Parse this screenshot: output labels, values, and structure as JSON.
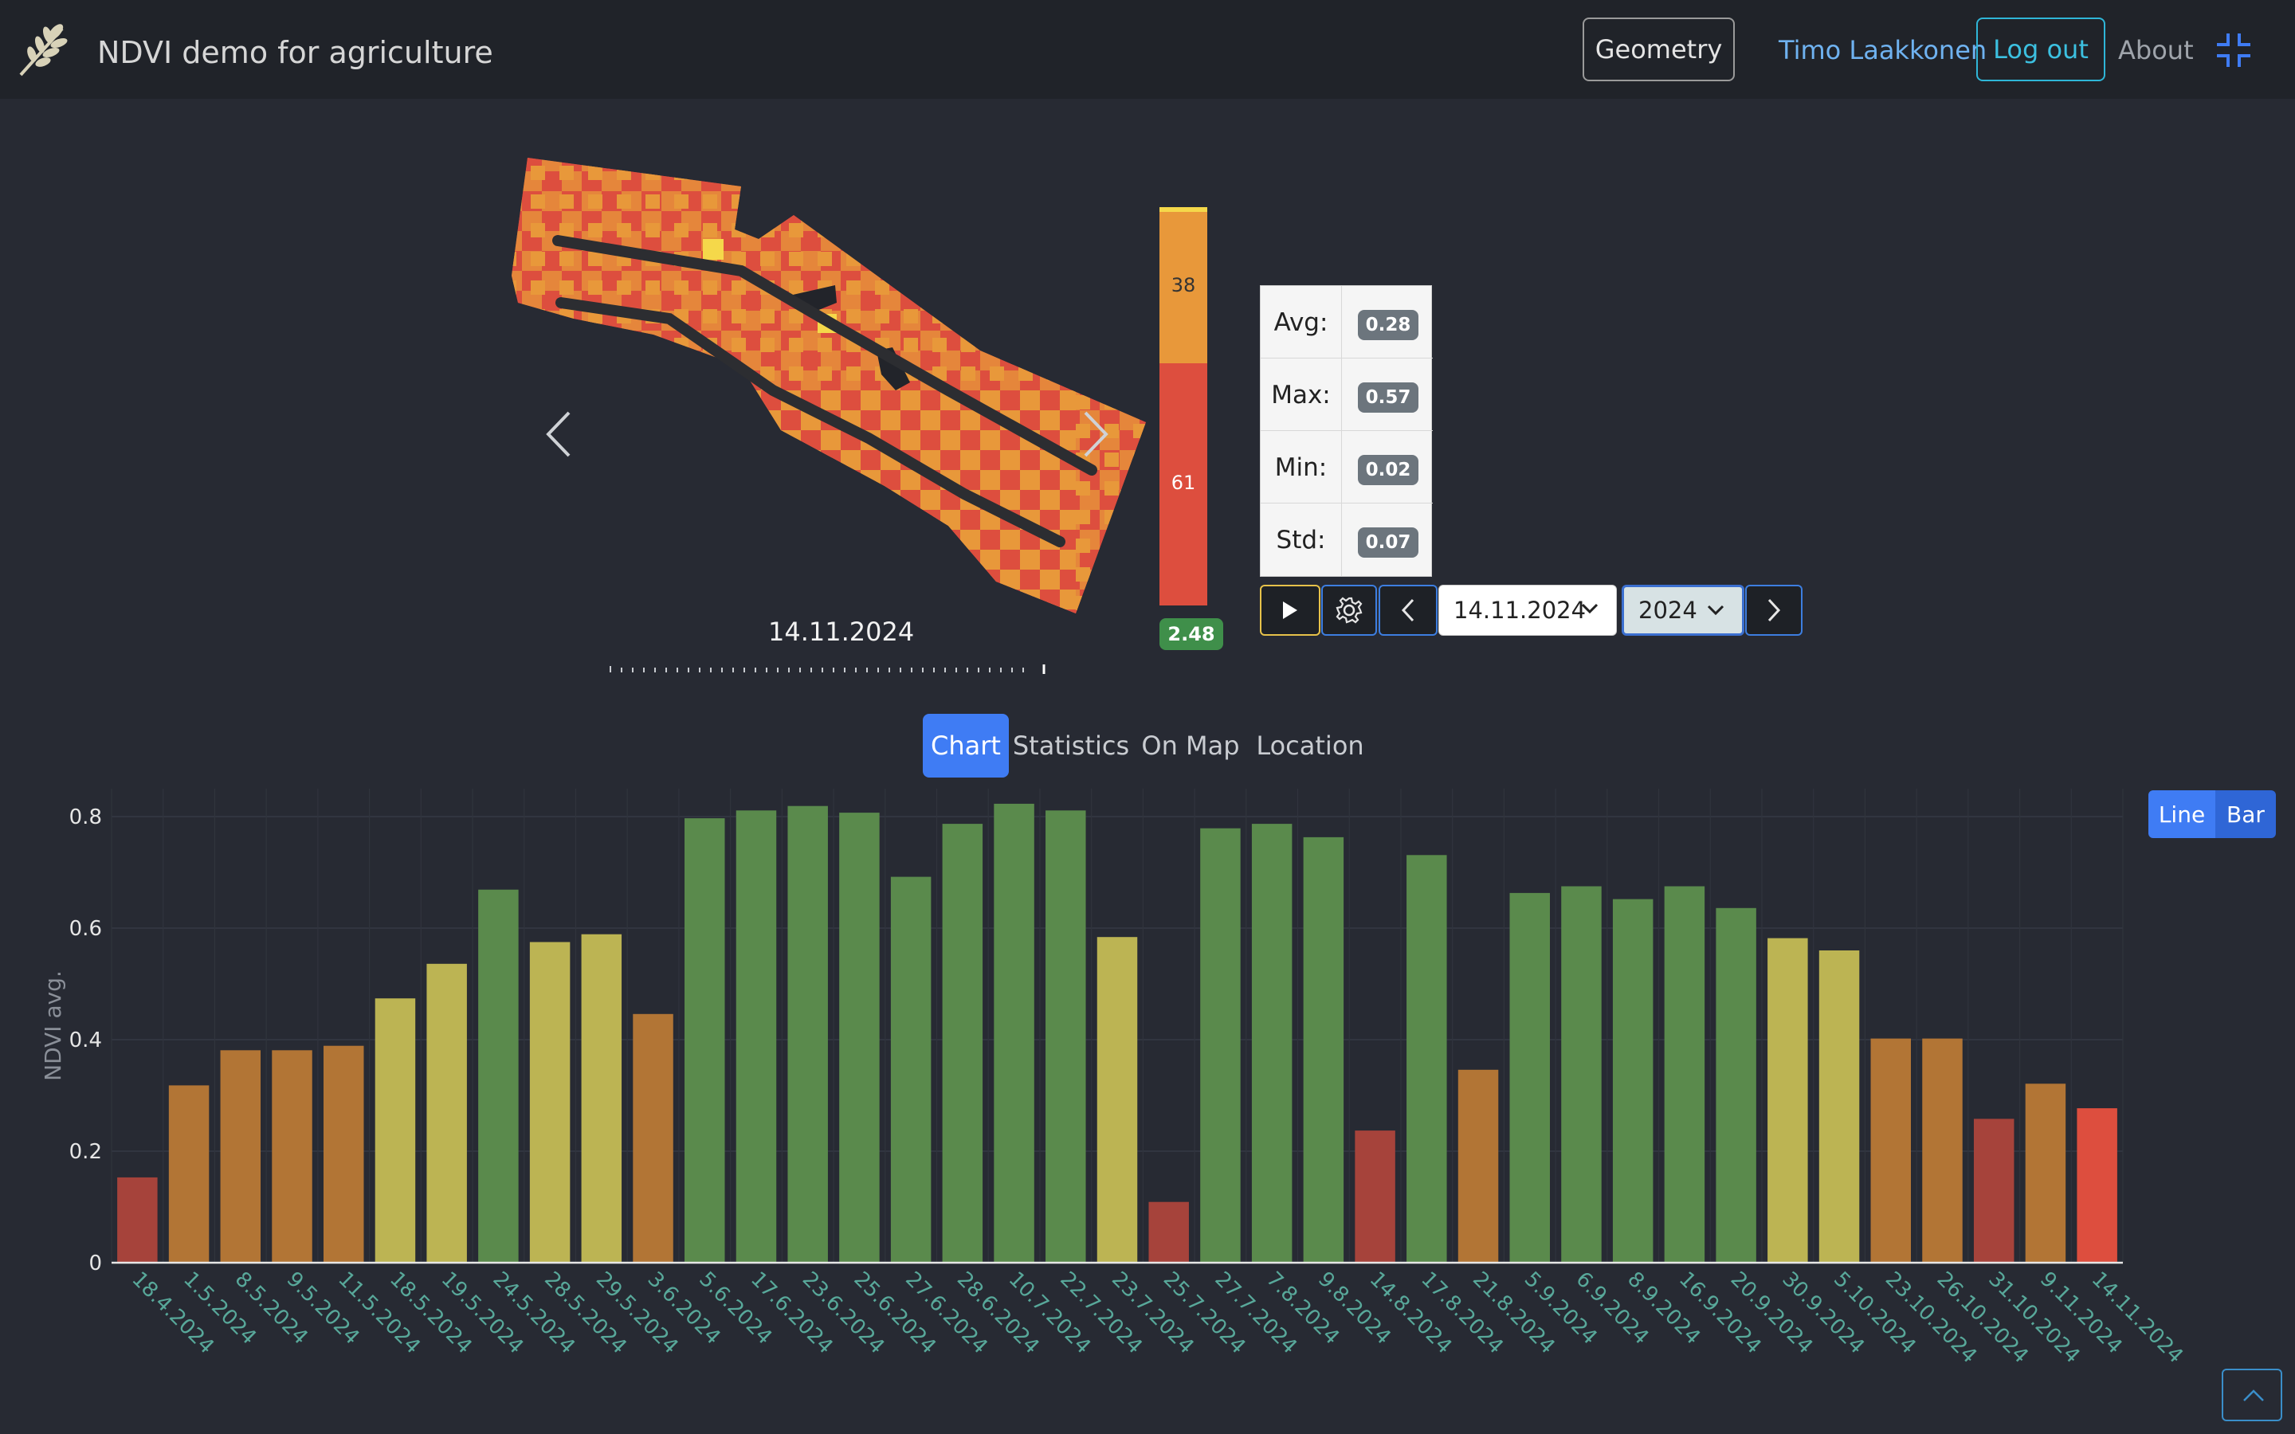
{
  "app": {
    "title": "NDVI demo for agriculture",
    "logo_icon": "wheat-icon"
  },
  "nav": {
    "geometry_label": "Geometry",
    "user_name": "Timo Laakkonen",
    "logout_label": "Log out",
    "about_label": "About",
    "fullscreen_icon": "collapse-icon"
  },
  "viewer": {
    "current_date": "14.11.2024",
    "legend": {
      "orange_count": "38",
      "red_count": "61",
      "total": "2.48"
    },
    "stats": [
      {
        "label": "Avg:",
        "value": "0.28"
      },
      {
        "label": "Max:",
        "value": "0.57"
      },
      {
        "label": "Min:",
        "value": "0.02"
      },
      {
        "label": "Std:",
        "value": "0.07"
      }
    ],
    "controls": {
      "date_select": "14.11.2024",
      "year_select": "2024"
    }
  },
  "tabs": [
    {
      "label": "Chart",
      "active": true
    },
    {
      "label": "Statistics",
      "active": false
    },
    {
      "label": "On Map",
      "active": false
    },
    {
      "label": "Location",
      "active": false
    }
  ],
  "chart_toggle": {
    "line_label": "Line",
    "bar_label": "Bar"
  },
  "colors": {
    "accent": "#3f7cf4",
    "green": "#5a8a4c",
    "yellow": "#bcb453",
    "orange": "#b27535",
    "dark_red": "#a6433b",
    "bright_red": "#dd4e3e"
  },
  "chart_data": {
    "type": "bar",
    "ylabel": "NDVI avg.",
    "ylim": [
      0,
      0.85
    ],
    "yticks": [
      "0",
      "0.2",
      "0.4",
      "0.6",
      "0.8"
    ],
    "grid": true,
    "categories": [
      "18.4.2024",
      "1.5.2024",
      "8.5.2024",
      "9.5.2024",
      "11.5.2024",
      "18.5.2024",
      "19.5.2024",
      "24.5.2024",
      "28.5.2024",
      "29.5.2024",
      "3.6.2024",
      "5.6.2024",
      "17.6.2024",
      "23.6.2024",
      "25.6.2024",
      "27.6.2024",
      "28.6.2024",
      "10.7.2024",
      "22.7.2024",
      "23.7.2024",
      "25.7.2024",
      "27.7.2024",
      "7.8.2024",
      "9.8.2024",
      "14.8.2024",
      "17.8.2024",
      "21.8.2024",
      "5.9.2024",
      "6.9.2024",
      "8.9.2024",
      "16.9.2024",
      "20.9.2024",
      "30.9.2024",
      "5.10.2024",
      "23.10.2024",
      "26.10.2024",
      "31.10.2024",
      "9.11.2024",
      "14.11.2024"
    ],
    "values": [
      0.153,
      0.318,
      0.381,
      0.381,
      0.389,
      0.474,
      0.536,
      0.669,
      0.575,
      0.589,
      0.446,
      0.797,
      0.811,
      0.819,
      0.807,
      0.692,
      0.787,
      0.823,
      0.811,
      0.584,
      0.109,
      0.779,
      0.787,
      0.763,
      0.237,
      0.731,
      0.346,
      0.663,
      0.675,
      0.652,
      0.675,
      0.636,
      0.582,
      0.56,
      0.402,
      0.402,
      0.258,
      0.321,
      0.277
    ],
    "bar_colors": [
      "#a6433b",
      "#b27535",
      "#b27535",
      "#b27535",
      "#b27535",
      "#bcb453",
      "#bcb453",
      "#5a8a4c",
      "#bcb453",
      "#bcb453",
      "#b27535",
      "#5a8a4c",
      "#5a8a4c",
      "#5a8a4c",
      "#5a8a4c",
      "#5a8a4c",
      "#5a8a4c",
      "#5a8a4c",
      "#5a8a4c",
      "#bcb453",
      "#a6433b",
      "#5a8a4c",
      "#5a8a4c",
      "#5a8a4c",
      "#a6433b",
      "#5a8a4c",
      "#b27535",
      "#5a8a4c",
      "#5a8a4c",
      "#5a8a4c",
      "#5a8a4c",
      "#5a8a4c",
      "#bcb453",
      "#bcb453",
      "#b27535",
      "#b27535",
      "#a6433b",
      "#b27535",
      "#dd4e3e"
    ]
  }
}
